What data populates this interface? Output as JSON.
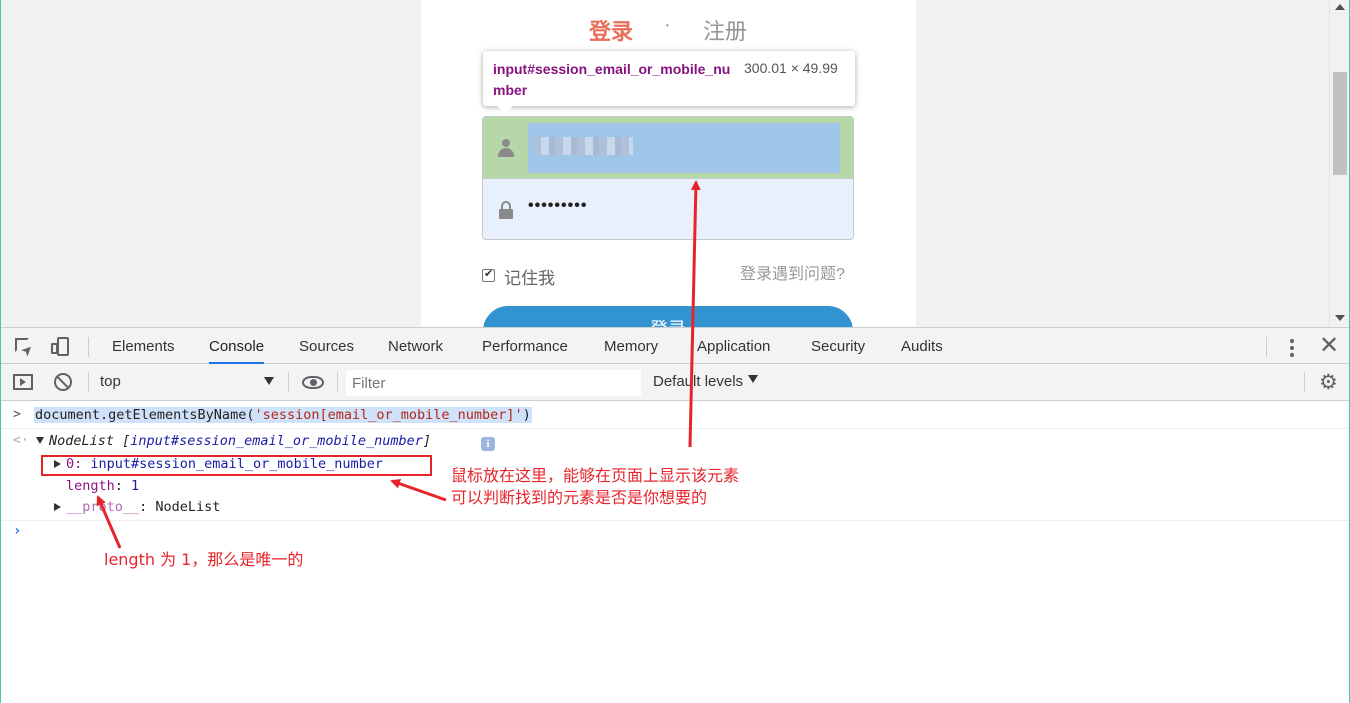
{
  "page": {
    "tab_login": "登录",
    "tab_dot": "·",
    "tab_register": "注册",
    "password_value": "•••••••••",
    "remember_label": "记住我",
    "forgot_link": "登录遇到问题?",
    "login_button": "登录"
  },
  "tooltip": {
    "tag": "input#session_email_or_mobile_number",
    "size": "300.01 × 49.99"
  },
  "devtools": {
    "tabs": [
      "Elements",
      "Console",
      "Sources",
      "Network",
      "Performance",
      "Memory",
      "Application",
      "Security",
      "Audits"
    ],
    "active_tab": "Console",
    "context": "top",
    "filter_placeholder": "Filter",
    "levels": "Default levels"
  },
  "console": {
    "cmd_prefix": "document.getElementsByName(",
    "cmd_string": "'session[email_or_mobile_number]'",
    "cmd_suffix": ")",
    "result_nodelist": "NodeList ",
    "result_bracket_open": "[",
    "result_item": "input#session_email_or_mobile_number",
    "result_bracket_close": "]",
    "row0_index": "0: ",
    "row0_value": "input#session_email_or_mobile_number",
    "length_key": "length",
    "length_sep": ": ",
    "length_value": "1",
    "proto_key": "__proto__",
    "proto_value": ": NodeList",
    "info_glyph": "i"
  },
  "annotations": {
    "hover_line1": "鼠标放在这里，能够在页面上显示该元素",
    "hover_line2": "可以判断找到的元素是否是你想要的",
    "length_note": "length 为 1，那么是唯一的"
  },
  "colors": {
    "accent": "#ea6f5a",
    "annotation": "#e8242b",
    "devtools_active": "#1a73e8",
    "login_button": "#3194d0"
  }
}
